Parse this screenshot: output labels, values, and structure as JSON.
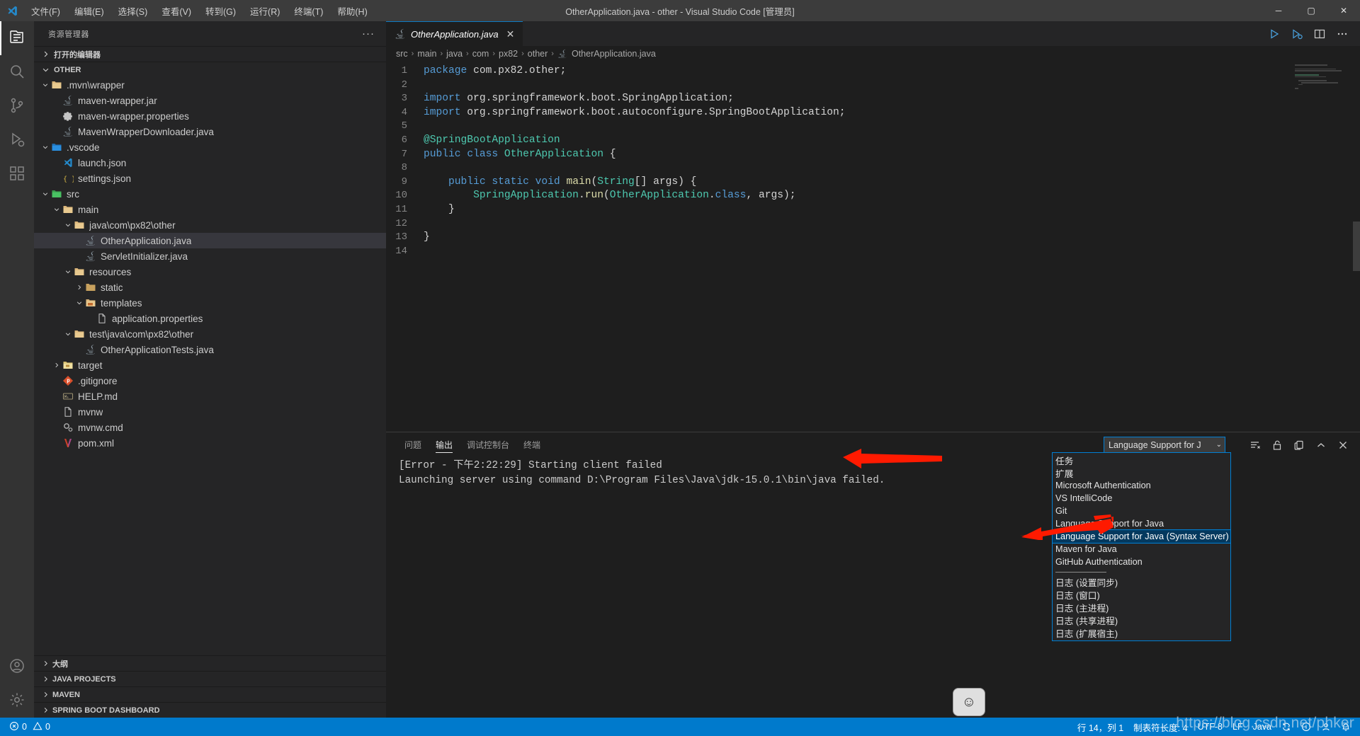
{
  "titlebar": {
    "logo_icon": "vscode-logo-icon",
    "menus": [
      "文件(F)",
      "编辑(E)",
      "选择(S)",
      "查看(V)",
      "转到(G)",
      "运行(R)",
      "终端(T)",
      "帮助(H)"
    ],
    "title": "OtherApplication.java - other - Visual Studio Code [管理员]",
    "minimize": "─",
    "maximize": "▢",
    "close": "✕"
  },
  "activitybar": {
    "items": [
      {
        "name": "explorer",
        "icon": "files-icon",
        "active": true
      },
      {
        "name": "search",
        "icon": "search-icon",
        "active": false
      },
      {
        "name": "source-control",
        "icon": "source-control-icon",
        "active": false
      },
      {
        "name": "run-and-debug",
        "icon": "run-debug-icon",
        "active": false
      },
      {
        "name": "extensions",
        "icon": "extensions-icon",
        "active": false
      }
    ],
    "bottom": [
      {
        "name": "accounts",
        "icon": "account-icon"
      },
      {
        "name": "manage",
        "icon": "gear-icon"
      }
    ]
  },
  "sidebar": {
    "header": "资源管理器",
    "more_actions": "···",
    "open_editors": "打开的编辑器",
    "workspace": "OTHER",
    "tree": [
      {
        "label": ".mvn\\wrapper",
        "depth": 1,
        "type": "folder",
        "icon": "folder-open-icon",
        "expanded": true
      },
      {
        "label": "maven-wrapper.jar",
        "depth": 2,
        "type": "file",
        "icon": "java-icon"
      },
      {
        "label": "maven-wrapper.properties",
        "depth": 2,
        "type": "file",
        "icon": "gear-file-icon"
      },
      {
        "label": "MavenWrapperDownloader.java",
        "depth": 2,
        "type": "file",
        "icon": "java-icon"
      },
      {
        "label": ".vscode",
        "depth": 1,
        "type": "folder",
        "icon": "vscode-folder-icon",
        "expanded": true
      },
      {
        "label": "launch.json",
        "depth": 2,
        "type": "file",
        "icon": "vscode-json-icon"
      },
      {
        "label": "settings.json",
        "depth": 2,
        "type": "file",
        "icon": "json-icon"
      },
      {
        "label": "src",
        "depth": 1,
        "type": "folder",
        "icon": "src-folder-icon",
        "expanded": true
      },
      {
        "label": "main",
        "depth": 2,
        "type": "folder",
        "icon": "folder-open-icon",
        "expanded": true
      },
      {
        "label": "java\\com\\px82\\other",
        "depth": 3,
        "type": "folder",
        "icon": "folder-open-icon",
        "expanded": true
      },
      {
        "label": "OtherApplication.java",
        "depth": 4,
        "type": "file",
        "icon": "java-icon",
        "selected": true
      },
      {
        "label": "ServletInitializer.java",
        "depth": 4,
        "type": "file",
        "icon": "java-icon"
      },
      {
        "label": "resources",
        "depth": 3,
        "type": "folder",
        "icon": "folder-open-icon",
        "expanded": true
      },
      {
        "label": "static",
        "depth": 4,
        "type": "folder",
        "icon": "folder-icon",
        "expanded": false
      },
      {
        "label": "templates",
        "depth": 4,
        "type": "folder",
        "icon": "templates-folder-icon",
        "expanded": true
      },
      {
        "label": "application.properties",
        "depth": 5,
        "type": "file",
        "icon": "file-icon"
      },
      {
        "label": "test\\java\\com\\px82\\other",
        "depth": 3,
        "type": "folder",
        "icon": "folder-open-icon",
        "expanded": true
      },
      {
        "label": "OtherApplicationTests.java",
        "depth": 4,
        "type": "file",
        "icon": "java-icon"
      },
      {
        "label": "target",
        "depth": 2,
        "type": "folder",
        "icon": "target-folder-icon",
        "expanded": false
      },
      {
        "label": ".gitignore",
        "depth": 2,
        "type": "file",
        "icon": "git-icon"
      },
      {
        "label": "HELP.md",
        "depth": 2,
        "type": "file",
        "icon": "markdown-icon"
      },
      {
        "label": "mvnw",
        "depth": 2,
        "type": "file",
        "icon": "file-icon"
      },
      {
        "label": "mvnw.cmd",
        "depth": 2,
        "type": "file",
        "icon": "cmd-icon"
      },
      {
        "label": "pom.xml",
        "depth": 2,
        "type": "file",
        "icon": "maven-icon"
      }
    ],
    "bottom_sections": [
      "大纲",
      "JAVA PROJECTS",
      "MAVEN",
      "SPRING BOOT DASHBOARD"
    ]
  },
  "editor": {
    "tab": {
      "label": "OtherApplication.java",
      "icon": "java-icon",
      "close": "✕"
    },
    "actions": [
      {
        "name": "run-file",
        "icon": "play-icon"
      },
      {
        "name": "run-and-debug",
        "icon": "debug-play-icon"
      },
      {
        "name": "split-editor",
        "icon": "split-editor-icon"
      },
      {
        "name": "more-actions",
        "icon": "ellipsis-icon"
      }
    ],
    "breadcrumb": [
      "src",
      "main",
      "java",
      "com",
      "px82",
      "other",
      "OtherApplication.java"
    ],
    "breadcrumb_sep": "›",
    "lines": [
      {
        "n": 1,
        "tokens": [
          {
            "t": "package",
            "c": "k"
          },
          {
            "t": " com.px82.other;",
            "c": "p"
          }
        ]
      },
      {
        "n": 2,
        "tokens": []
      },
      {
        "n": 3,
        "tokens": [
          {
            "t": "import",
            "c": "k"
          },
          {
            "t": " org.springframework.boot.SpringApplication;",
            "c": "p"
          }
        ]
      },
      {
        "n": 4,
        "tokens": [
          {
            "t": "import",
            "c": "k"
          },
          {
            "t": " org.springframework.boot.autoconfigure.SpringBootApplication;",
            "c": "p"
          }
        ]
      },
      {
        "n": 5,
        "tokens": []
      },
      {
        "n": 6,
        "tokens": [
          {
            "t": "@SpringBootApplication",
            "c": "t"
          }
        ]
      },
      {
        "n": 7,
        "tokens": [
          {
            "t": "public",
            "c": "k"
          },
          {
            "t": " ",
            "c": "p"
          },
          {
            "t": "class",
            "c": "k"
          },
          {
            "t": " ",
            "c": "p"
          },
          {
            "t": "OtherApplication",
            "c": "t"
          },
          {
            "t": " {",
            "c": "p"
          }
        ]
      },
      {
        "n": 8,
        "tokens": []
      },
      {
        "n": 9,
        "tokens": [
          {
            "t": "    ",
            "c": "p"
          },
          {
            "t": "public",
            "c": "k"
          },
          {
            "t": " ",
            "c": "p"
          },
          {
            "t": "static",
            "c": "k"
          },
          {
            "t": " ",
            "c": "p"
          },
          {
            "t": "void",
            "c": "k"
          },
          {
            "t": " ",
            "c": "p"
          },
          {
            "t": "main",
            "c": "f"
          },
          {
            "t": "(",
            "c": "p"
          },
          {
            "t": "String",
            "c": "t"
          },
          {
            "t": "[] args) {",
            "c": "p"
          }
        ]
      },
      {
        "n": 10,
        "tokens": [
          {
            "t": "        ",
            "c": "p"
          },
          {
            "t": "SpringApplication",
            "c": "t"
          },
          {
            "t": ".",
            "c": "p"
          },
          {
            "t": "run",
            "c": "f"
          },
          {
            "t": "(",
            "c": "p"
          },
          {
            "t": "OtherApplication",
            "c": "t"
          },
          {
            "t": ".",
            "c": "p"
          },
          {
            "t": "class",
            "c": "k"
          },
          {
            "t": ", args);",
            "c": "p"
          }
        ]
      },
      {
        "n": 11,
        "tokens": [
          {
            "t": "    }",
            "c": "p"
          }
        ]
      },
      {
        "n": 12,
        "tokens": []
      },
      {
        "n": 13,
        "tokens": [
          {
            "t": "}",
            "c": "p"
          }
        ]
      },
      {
        "n": 14,
        "tokens": []
      }
    ]
  },
  "panel": {
    "tabs": [
      {
        "label": "问题",
        "active": false
      },
      {
        "label": "输出",
        "active": true
      },
      {
        "label": "调试控制台",
        "active": false
      },
      {
        "label": "终端",
        "active": false
      }
    ],
    "output_lines": [
      "[Error - 下午2:22:29] Starting client failed",
      "Launching server using command D:\\Program Files\\Java\\jdk-15.0.1\\bin\\java failed."
    ],
    "selected_channel": "Language Support for J",
    "chevron": "⌄",
    "actions": [
      {
        "name": "clear-output",
        "icon": "clear-icon"
      },
      {
        "name": "lock-scroll",
        "icon": "unlock-icon"
      },
      {
        "name": "open-in-editor",
        "icon": "open-editor-icon"
      },
      {
        "name": "maximize-panel",
        "icon": "chevron-up-icon"
      },
      {
        "name": "close-panel",
        "icon": "close-icon"
      }
    ],
    "dropdown": {
      "items": [
        {
          "label": "任务",
          "selected": false
        },
        {
          "label": "扩展",
          "selected": false
        },
        {
          "label": "Microsoft Authentication",
          "selected": false
        },
        {
          "label": "VS IntelliCode",
          "selected": false
        },
        {
          "label": "Git",
          "selected": false
        },
        {
          "label": "Language Support for Java",
          "selected": false
        },
        {
          "label": "Language Support for Java (Syntax Server)",
          "selected": true
        },
        {
          "label": "Maven for Java",
          "selected": false
        },
        {
          "label": "GitHub Authentication",
          "selected": false
        },
        {
          "separator": true
        },
        {
          "label": "日志 (设置同步)",
          "selected": false
        },
        {
          "label": "日志 (窗口)",
          "selected": false
        },
        {
          "label": "日志 (主进程)",
          "selected": false
        },
        {
          "label": "日志 (共享进程)",
          "selected": false
        },
        {
          "label": "日志 (扩展宿主)",
          "selected": false
        }
      ]
    }
  },
  "statusbar": {
    "errors": "0",
    "warnings": "0",
    "error_icon": "error-circle-icon",
    "warning_icon": "warning-triangle-icon",
    "right": [
      {
        "label": "行 14，列 1",
        "name": "cursor-position"
      },
      {
        "label": "制表符长度: 4",
        "name": "indentation"
      },
      {
        "label": "UTF-8",
        "name": "encoding"
      },
      {
        "label": "LF",
        "name": "eol"
      },
      {
        "label": "Java",
        "name": "language-mode"
      }
    ],
    "right_icons": [
      {
        "name": "sync-icon"
      },
      {
        "name": "info-icon"
      },
      {
        "name": "person-icon"
      },
      {
        "name": "bell-icon"
      }
    ]
  },
  "overlay": {
    "watermark": "https://blog.csdn.net/phker",
    "smiley": "☺",
    "accent_blue": "#007acc",
    "arrow_red": "#ff1a00"
  }
}
